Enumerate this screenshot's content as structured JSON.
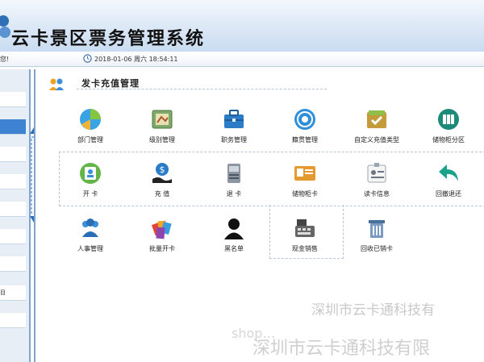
{
  "app": {
    "title": "云卡景区票务管理系统"
  },
  "status": {
    "greeting": "您!",
    "datetime": "2018-01-06  周六  18:54:11"
  },
  "sidebar": {
    "partial_item_text": "目"
  },
  "panel": {
    "title": "发卡充值管理"
  },
  "tiles": [
    {
      "label": "部门管理",
      "icon": "department-icon"
    },
    {
      "label": "级别管理",
      "icon": "level-icon"
    },
    {
      "label": "职务管理",
      "icon": "position-icon"
    },
    {
      "label": "籍贯管理",
      "icon": "hometown-icon"
    },
    {
      "label": "自定义充值类型",
      "icon": "custom-recharge-icon"
    },
    {
      "label": "储物柜分区",
      "icon": "locker-zone-icon"
    },
    {
      "label": "开 卡",
      "icon": "open-card-icon"
    },
    {
      "label": "充 值",
      "icon": "recharge-icon"
    },
    {
      "label": "退 卡",
      "icon": "return-card-icon"
    },
    {
      "label": "储物柜卡",
      "icon": "locker-card-icon"
    },
    {
      "label": "读卡信息",
      "icon": "read-card-icon"
    },
    {
      "label": "回撤退还",
      "icon": "refund-icon"
    },
    {
      "label": "人事管理",
      "icon": "personnel-icon"
    },
    {
      "label": "批量开卡",
      "icon": "batch-open-icon"
    },
    {
      "label": "黑名单",
      "icon": "blacklist-icon"
    },
    {
      "label": "现金销售",
      "icon": "cash-sale-icon"
    },
    {
      "label": "回收已销卡",
      "icon": "recycle-card-icon"
    }
  ],
  "watermark": {
    "line1": "深圳市云卡通科技有",
    "line2": "shop…",
    "line3": "深圳市云卡通科技有限"
  },
  "colors": {
    "accent": "#3e83d1",
    "header_bg": "#dfeaf7",
    "border": "#7ea4cf"
  }
}
